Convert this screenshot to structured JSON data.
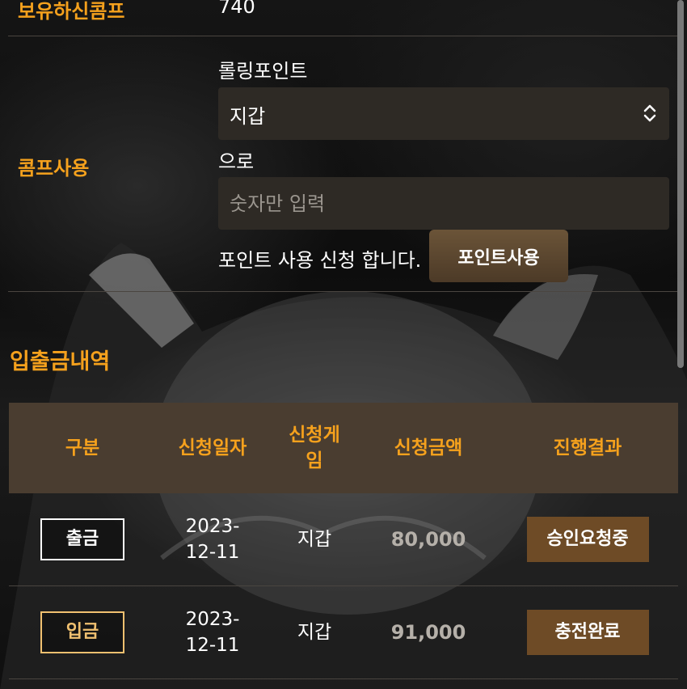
{
  "account": {
    "comp_label": "보유하신콤프",
    "comp_value": "740"
  },
  "comp_use": {
    "label": "콤프사용",
    "rolling_label": "롤링포인트",
    "wallet_select": {
      "selected": "지갑",
      "options": [
        "지갑"
      ]
    },
    "to_label": "으로",
    "amount_input": {
      "value": "",
      "placeholder": "숫자만 입력"
    },
    "apply_text": "포인트 사용 신청 합니다.",
    "submit_button": "포인트사용"
  },
  "history": {
    "title": "입출금내역",
    "columns": [
      "구분",
      "신청일자",
      "신청게임",
      "신청금액",
      "진행결과"
    ],
    "rows": [
      {
        "type": "출금",
        "type_kind": "withdraw",
        "date_line1": "2023-",
        "date_line2": "12-11",
        "game": "지갑",
        "amount": "80,000",
        "status": "승인요청중"
      },
      {
        "type": "입금",
        "type_kind": "deposit",
        "date_line1": "2023-",
        "date_line2": "12-11",
        "game": "지갑",
        "amount": "91,000",
        "status": "충전완료"
      }
    ]
  },
  "colors": {
    "accent": "#f5a11d",
    "table_header_bg": "#4a3d30",
    "field_bg": "#2e2a25",
    "status_bg": "#6e4b26",
    "button_bg": "#5c4730"
  },
  "icons": {
    "select_arrow": "chevron-up-down-icon"
  }
}
